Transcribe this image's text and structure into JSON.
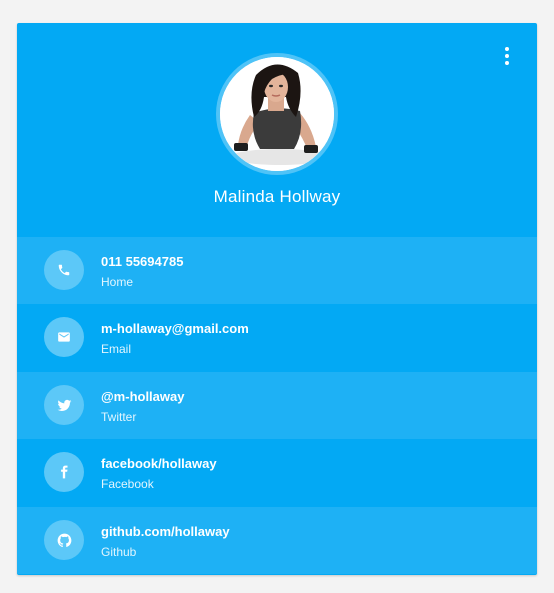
{
  "profile": {
    "name": "Malinda Hollway"
  },
  "colors": {
    "accent": "#03a9f4",
    "row_alt": "#1eb1f5",
    "icon_bg": "#5cc8f8",
    "background": "#f3f3f3"
  },
  "contacts": [
    {
      "value": "011 55694785",
      "label": "Home",
      "icon": "phone-icon"
    },
    {
      "value": "m-hollaway@gmail.com",
      "label": "Email",
      "icon": "mail-icon"
    },
    {
      "value": "@m-hollaway",
      "label": "Twitter",
      "icon": "twitter-icon"
    },
    {
      "value": "facebook/hollaway",
      "label": "Facebook",
      "icon": "facebook-icon"
    },
    {
      "value": "github.com/hollaway",
      "label": "Github",
      "icon": "github-icon"
    }
  ]
}
